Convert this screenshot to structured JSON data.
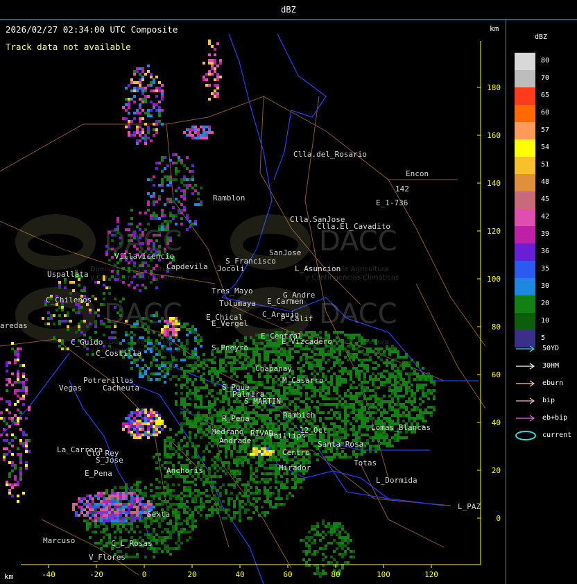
{
  "header": {
    "title": "dBZ"
  },
  "plot": {
    "timestamp": "2026/02/27 02:34:00 UTC Composite",
    "notice": "Track data not available",
    "axis_unit_top": "km",
    "axis_unit_bottom": "km",
    "x_ticks": [
      "-40",
      "-20",
      "0",
      "20",
      "40",
      "60",
      "80",
      "100",
      "120"
    ],
    "y_ticks": [
      "180",
      "160",
      "140",
      "120",
      "100",
      "80",
      "60",
      "40",
      "20",
      "0"
    ],
    "watermark": {
      "brand": "DACC",
      "tagline_1": "Dirección de Agricultura",
      "tagline_2": "y Contingencias Climáticas"
    },
    "places": [
      "Clla.del_Rosario",
      "Encon",
      "142",
      "E_1-736",
      "Ramblon",
      "Clla.SanJose",
      "Clla.El_Cavadito",
      "Villavicencio",
      "Capdevila",
      "S_Francisco",
      "SanJose",
      "L_Asuncion",
      "Uspallata",
      "Jocoli",
      "Tres_Mayo",
      "Tulumaya",
      "E_Carmen",
      "G_Andre",
      "C_Chilenos",
      "E_Chical",
      "E_Vergel",
      "C_Araujo",
      "P_Calif",
      "aredas",
      "C_Guido",
      "E_Central",
      "E_Vizcadero",
      "C_Costilla",
      "S_Pneyro",
      "Potrerillos",
      "Vegas",
      "Cacheuta",
      "Chapanay",
      "M_Casarro",
      "S_Pque",
      "Palmira",
      "S_MARTIN",
      "Rambich",
      "R_Pena",
      "RIVAD",
      "Medrano",
      "Phillips",
      "12_Oct",
      "Andrade",
      "Lomas_Blancas",
      "La_Carrera",
      "Cto_Rey",
      "S_Jose",
      "Santa_Rosa",
      "Centro",
      "E_Pena",
      "Anchoris",
      "Mirador",
      "Totas",
      "L_Dormida",
      "L_PAZ",
      "Sexta",
      "Marcuso",
      "C_L_Rosas",
      "V_Flores"
    ]
  },
  "legend": {
    "title": "dBZ",
    "scale": [
      {
        "label": "80",
        "color": "#d8d8d8"
      },
      {
        "label": "70",
        "color": "#bdbdbd"
      },
      {
        "label": "65",
        "color": "#ff3b1e"
      },
      {
        "label": "60",
        "color": "#ff6a00"
      },
      {
        "label": "57",
        "color": "#ff9b5a"
      },
      {
        "label": "54",
        "color": "#ffff00"
      },
      {
        "label": "51",
        "color": "#f8c12b"
      },
      {
        "label": "48",
        "color": "#e0903a"
      },
      {
        "label": "45",
        "color": "#c96a7a"
      },
      {
        "label": "42",
        "color": "#e04fb0"
      },
      {
        "label": "39",
        "color": "#c01fa8"
      },
      {
        "label": "36",
        "color": "#6a1fd6"
      },
      {
        "label": "35",
        "color": "#2a5af0"
      },
      {
        "label": "30",
        "color": "#1e88e0"
      },
      {
        "label": "20",
        "color": "#128012"
      },
      {
        "label": "10",
        "color": "#0b5f0b"
      },
      {
        "label": "5",
        "color": "#3b2f8a"
      }
    ],
    "tracks": [
      {
        "label": "50YD",
        "color": "#38d8d8"
      },
      {
        "label": "30HM",
        "color": "#ffffff"
      },
      {
        "label": "eburn",
        "color": "#ffd27f"
      },
      {
        "label": "bip",
        "color": "#ffb6d9"
      },
      {
        "label": "eb+bip",
        "color": "#e070e0"
      },
      {
        "label": "current",
        "color": "#38d8d8"
      }
    ],
    "map_colors": {
      "boundary_blue": "#2a3cff",
      "roads_brown": "#8a5a2a",
      "text": "#d8d8d8",
      "axis_yellow": "#ffff00",
      "frame_teal": "#2aa6a6"
    }
  }
}
